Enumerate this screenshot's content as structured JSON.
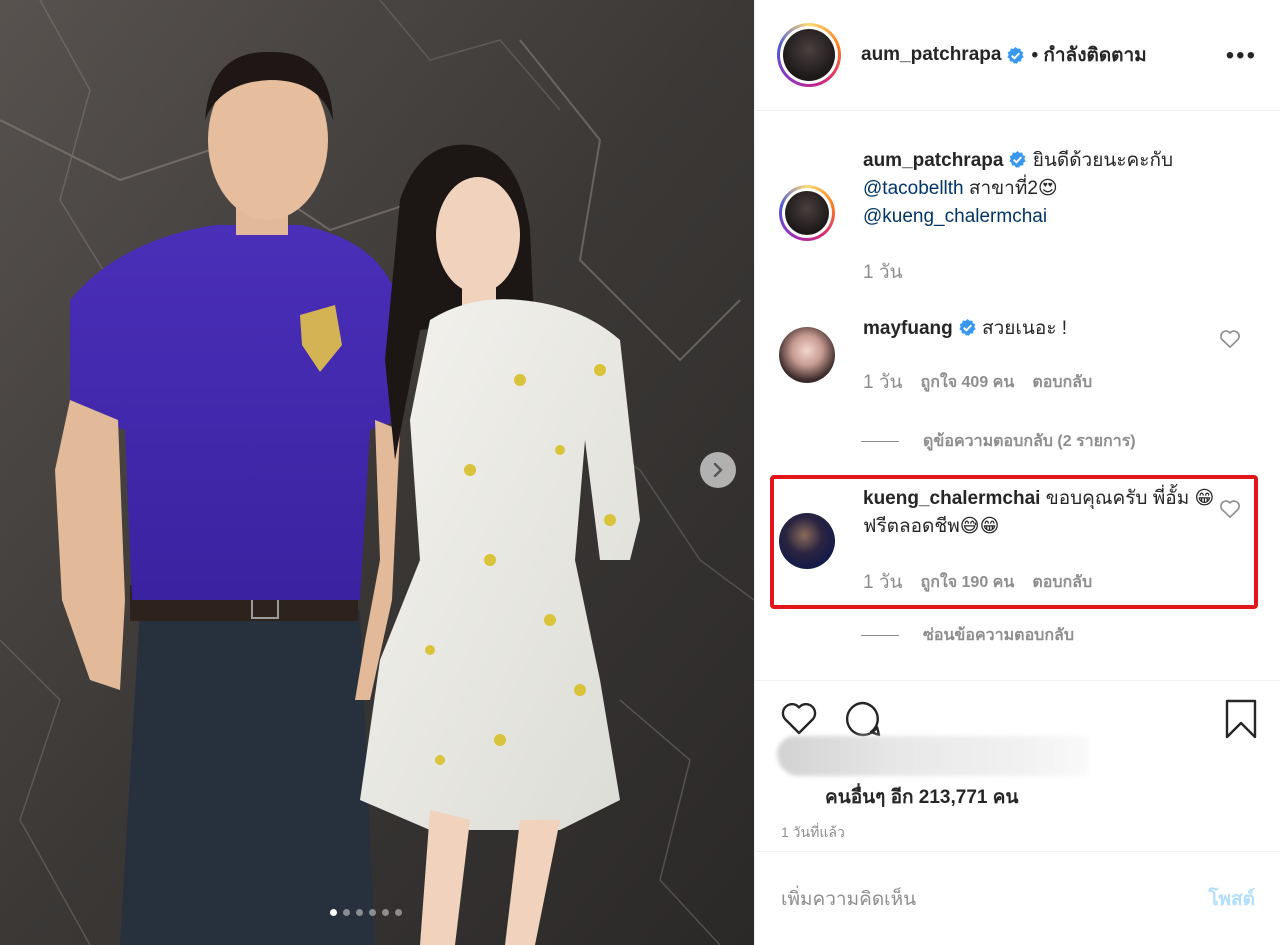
{
  "post": {
    "username": "aum_patchrapa",
    "follow_status": "• กำลังติดตาม",
    "more_label": "•••",
    "slide_count": 6,
    "active_slide": 1
  },
  "comments": [
    {
      "username": "aum_patchrapa",
      "text": "ยินดีด้วยนะคะกับ",
      "mention1": "@tacobellth",
      "text2": " สาขาที่2😍",
      "mention2": "@kueng_chalermchai",
      "time": "1 วัน"
    },
    {
      "username": "mayfuang",
      "text": "สวยเนอะ !",
      "time": "1 วัน",
      "likes": "ถูกใจ 409 คน",
      "reply": "ตอบกลับ",
      "view_replies": "ดูข้อความตอบกลับ (2 รายการ)"
    },
    {
      "username": "kueng_chalermchai",
      "text": "ขอบคุณครับ พี่อั้ม 😁ฟรีตลอดชีพ😅😁",
      "time": "1 วัน",
      "likes": "ถูกใจ 190 คน",
      "reply": "ตอบกลับ",
      "hide_replies": "ซ่อนข้อความตอบกลับ"
    }
  ],
  "likes_summary": "คนอื่นๆ อีก 213,771 คน",
  "posted_ago": "1 วันที่แล้ว",
  "add_comment_placeholder": "เพิ่มความคิดเห็น",
  "post_button": "โพสต์",
  "colors": {
    "highlight": "#e0161b",
    "verified": "#3897f0",
    "post_disabled": "#b2dffc"
  }
}
